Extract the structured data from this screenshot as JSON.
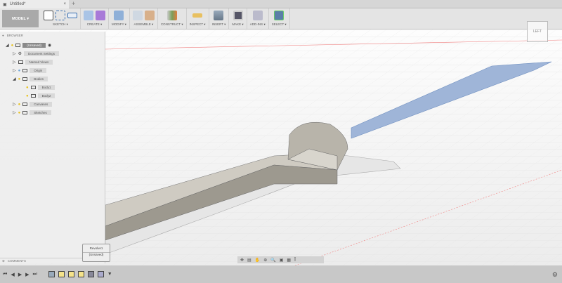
{
  "tab": {
    "title": "Untitled*",
    "close": "×",
    "new": "+"
  },
  "toolbar": {
    "workspace": "MODEL ▾",
    "groups": [
      "SKETCH ▾",
      "CREATE ▾",
      "MODIFY ▾",
      "ASSEMBLE ▾",
      "CONSTRUCT ▾",
      "INSPECT ▾",
      "INSERT ▾",
      "MAKE ▾",
      "ADD-INS ▾",
      "SELECT ▾"
    ]
  },
  "browser": {
    "title": "BROWSER",
    "root": "(Unsaved)",
    "items": [
      "Document Settings",
      "Named Views",
      "Origin",
      "Bodies",
      "Body1",
      "Body2",
      "Canvases",
      "Sketches"
    ]
  },
  "comments": "COMMENTS",
  "tooltip": {
    "feature": "Revolve1",
    "doc": "(Unsaved)"
  },
  "viewcube": "LEFT",
  "colors": {
    "accent": "#5a7fa8",
    "body": "#a8a49a"
  }
}
